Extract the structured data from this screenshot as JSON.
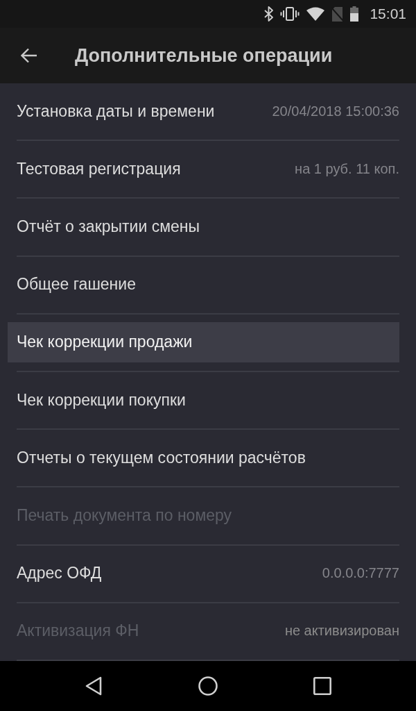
{
  "status_bar": {
    "time": "15:01"
  },
  "toolbar": {
    "title": "Дополнительные операции"
  },
  "items": [
    {
      "label": "Установка даты и времени",
      "value": "20/04/2018 15:00:36",
      "disabled": false,
      "selected": false
    },
    {
      "label": "Тестовая регистрация",
      "value": "на 1 руб. 11 коп.",
      "disabled": false,
      "selected": false
    },
    {
      "label": "Отчёт о закрытии смены",
      "disabled": false,
      "selected": false
    },
    {
      "label": "Общее гашение",
      "disabled": false,
      "selected": false
    },
    {
      "label": "Чек коррекции продажи",
      "disabled": false,
      "selected": true
    },
    {
      "label": "Чек коррекции покупки",
      "disabled": false,
      "selected": false
    },
    {
      "label": "Отчеты о текущем состоянии расчётов",
      "disabled": false,
      "selected": false
    },
    {
      "label": "Печать документа по номеру",
      "disabled": true,
      "selected": false
    },
    {
      "label": "Адрес ОФД",
      "value": "0.0.0.0:7777",
      "disabled": false,
      "selected": false
    },
    {
      "label": "Активизация ФН",
      "value": "не активизирован",
      "disabled": true,
      "selected": false
    }
  ]
}
